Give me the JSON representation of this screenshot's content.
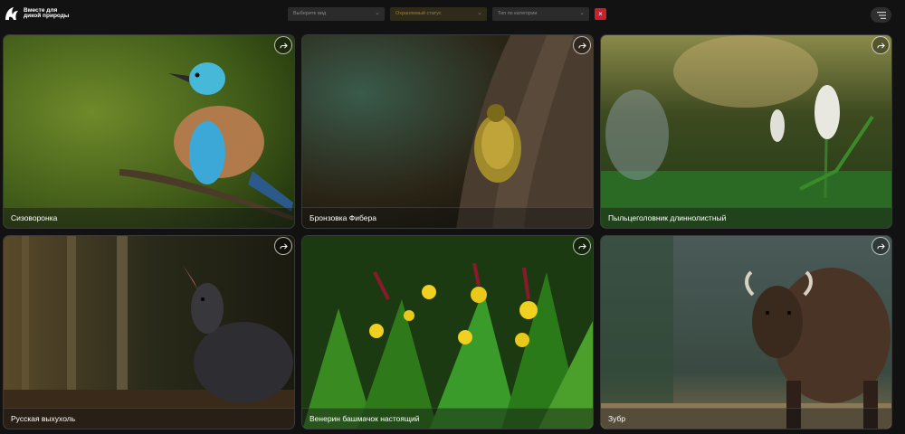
{
  "brand": {
    "logo_text": "Вместе для дикой природы"
  },
  "filters": {
    "select1": {
      "value": "Выберите вид"
    },
    "select2": {
      "value": "Охраняемый статус"
    },
    "select3": {
      "value": "Тип по категории"
    },
    "reset_icon": "close-icon"
  },
  "menu_icon": "filter-menu-icon",
  "cards": [
    {
      "title": "Сизоворонка"
    },
    {
      "title": "Бронзовка Фибера"
    },
    {
      "title": "Пыльцеголовник длиннолистный"
    },
    {
      "title": "Русская выхухоль"
    },
    {
      "title": "Венерин башмачок настоящий"
    },
    {
      "title": "Зубр"
    }
  ],
  "colors": {
    "background": "#121212",
    "reset": "#c8202c"
  }
}
